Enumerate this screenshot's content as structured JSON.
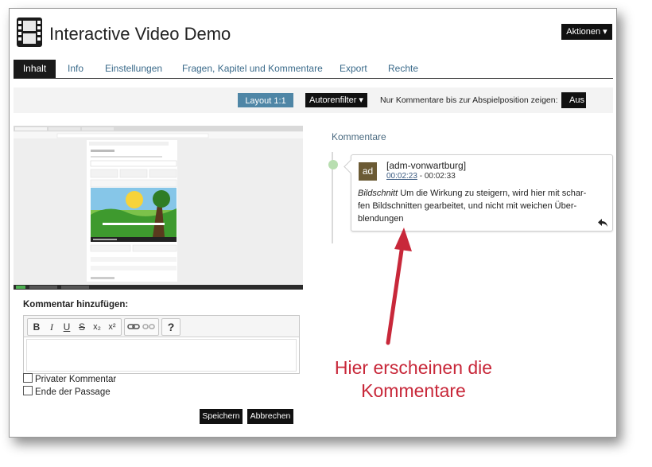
{
  "header": {
    "title": "Interactive Video Demo",
    "actions_label": "Aktionen ▾"
  },
  "tabs": [
    {
      "label": "Inhalt",
      "active": true
    },
    {
      "label": "Info"
    },
    {
      "label": "Einstellungen"
    },
    {
      "label": "Fragen, Kapitel und Kommentare"
    },
    {
      "label": "Export"
    },
    {
      "label": "Rechte"
    }
  ],
  "toolbar": {
    "layout_label": "Layout 1:1 ▾",
    "autorenfilter_label": "Autorenfilter ▾",
    "position_label": "Nur Kommentare bis zur Abspielposition zeigen:",
    "aus_label": "Aus"
  },
  "comments": {
    "heading": "Kommentare",
    "items": [
      {
        "avatar": "ad",
        "user": "[adm-vonwartburg]",
        "time_start": "00:02:23",
        "time_separator": " - ",
        "time_end": "00:02:33",
        "title": "Bildschnitt",
        "text_line1": "Um die Wirkung zu steigern, wird hier mit schar-",
        "text_line2": "fen Bildschnitten gearbeitet, und nicht mit weichen Über-",
        "text_line3": "blendungen"
      }
    ]
  },
  "annotation": {
    "line1": "Hier erscheinen die",
    "line2": "Kommentare",
    "color": "#c8283a"
  },
  "add_comment": {
    "label": "Kommentar hinzufügen:",
    "editor_buttons": [
      "B",
      "I",
      "U",
      "S",
      "x₂",
      "x²",
      "?"
    ],
    "private_label": "Privater Kommentar",
    "end_label": "Ende der Passage",
    "save_label": "Speichern",
    "cancel_label": "Abbrechen"
  },
  "colors": {
    "accent_blue": "#4f86a6",
    "dark_button": "#111111",
    "link": "#3a6a8a",
    "timeline_dot": "#b8deb0",
    "avatar_bg": "#6b5a34"
  }
}
